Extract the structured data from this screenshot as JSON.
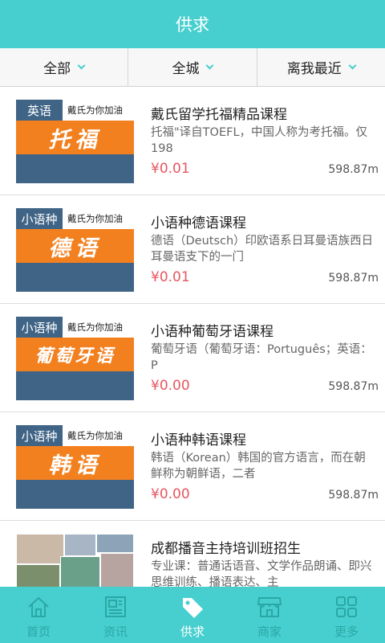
{
  "header": {
    "title": "供求"
  },
  "filters": [
    {
      "label": "全部"
    },
    {
      "label": "全城"
    },
    {
      "label": "离我最近"
    }
  ],
  "items": [
    {
      "thumb_tag": "英语",
      "thumb_slogan": "戴氏为你加油",
      "thumb_art": "托福",
      "title": "戴氏留学托福精品课程",
      "desc": "托福\"译自TOEFL，中国人称为考托福。仅198",
      "price": "¥0.01",
      "distance": "598.87m"
    },
    {
      "thumb_tag": "小语种",
      "thumb_slogan": "戴氏为你加油",
      "thumb_art": "德语",
      "title": "小语种德语课程",
      "desc": "德语（Deutsch）印欧语系日耳曼语族西日耳曼语支下的一门",
      "price": "¥0.01",
      "distance": "598.87m"
    },
    {
      "thumb_tag": "小语种",
      "thumb_slogan": "戴氏为你加油",
      "thumb_art": "葡萄牙语",
      "title": "小语种葡萄牙语课程",
      "desc": "葡萄牙语（葡萄牙语：Português；英语：P",
      "price": "¥0.00",
      "distance": "598.87m"
    },
    {
      "thumb_tag": "小语种",
      "thumb_slogan": "戴氏为你加油",
      "thumb_art": "韩语",
      "title": "小语种韩语课程",
      "desc": "韩语（Korean）韩国的官方语言，而在朝鲜称为朝鲜语，二者",
      "price": "¥0.00",
      "distance": "598.87m"
    },
    {
      "title": "成都播音主持培训班招生",
      "desc": "专业课：普通话语音、文学作品朗诵、即兴思维训练、播语表达、主"
    }
  ],
  "tabs": [
    {
      "label": "首页",
      "icon": "home-icon"
    },
    {
      "label": "资讯",
      "icon": "news-icon"
    },
    {
      "label": "供求",
      "icon": "tag-icon"
    },
    {
      "label": "商家",
      "icon": "store-icon"
    },
    {
      "label": "更多",
      "icon": "grid-icon"
    }
  ],
  "colors": {
    "accent": "#47cfcf",
    "price": "#e85560",
    "thumb_blue": "#3f6486",
    "thumb_orange": "#f3801f"
  }
}
